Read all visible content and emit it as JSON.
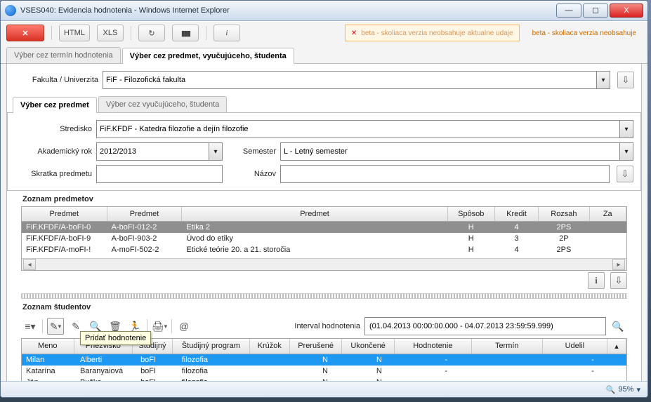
{
  "window": {
    "title": "VSES040: Evidencia hodnotenia - Windows Internet Explorer"
  },
  "toolbar": {
    "html": "HTML",
    "xls": "XLS"
  },
  "banner": {
    "msg": "beta - skoliaca verzia neobsahuje aktualne udaje",
    "msg2": "beta - skoliaca verzia neobsahuje"
  },
  "tabs_main": [
    {
      "label": "Výber cez termín hodnotenia"
    },
    {
      "label": "Výber cez predmet, vyučujúceho, študenta"
    }
  ],
  "form": {
    "fakulta_label": "Fakulta / Univerzita",
    "fakulta_value": "FiF - Filozofická fakulta"
  },
  "tabs_sub": [
    {
      "label": "Výber cez predmet"
    },
    {
      "label": "Výber cez vyučujúceho, študenta"
    }
  ],
  "filters": {
    "stredisko_label": "Stredisko",
    "stredisko_value": "FiF.KFDF - Katedra filozofie a dejín filozofie",
    "akrok_label": "Akademický rok",
    "akrok_value": "2012/2013",
    "semester_label": "Semester",
    "semester_value": "L - Letný semester",
    "skratka_label": "Skratka predmetu",
    "skratka_value": "",
    "nazov_label": "Názov",
    "nazov_value": ""
  },
  "section_predmety": "Zoznam predmetov",
  "grid1": {
    "cols": [
      "Predmet",
      "Predmet",
      "Predmet",
      "Spôsob",
      "Kredit",
      "Rozsah",
      "Za"
    ],
    "rows": [
      {
        "c": [
          "FiF.KFDF/A-boFI-0",
          "A-boFI-012-2",
          "Etika 2",
          "H",
          "4",
          "2PS",
          ""
        ],
        "sel": true
      },
      {
        "c": [
          "FiF.KFDF/A-boFI-9",
          "A-boFI-903-2",
          "Úvod do etiky",
          "H",
          "3",
          "2P",
          ""
        ]
      },
      {
        "c": [
          "FiF.KFDF/A-moFI-!",
          "A-moFI-502-2",
          "Etické teórie 20. a 21. storočia",
          "H",
          "4",
          "2PS",
          ""
        ]
      }
    ]
  },
  "section_studenti": "Zoznam študentov",
  "interval": {
    "label": "Interval hodnotenia",
    "value": "(01.04.2013 00:00:00.000 - 04.07.2013 23:59:59.999)"
  },
  "tooltip": "Pridať hodnotenie",
  "grid2": {
    "cols": [
      "Meno",
      "Priezvisko",
      "Študijný",
      "Študijný program",
      "Krúžok",
      "Prerušené",
      "Ukončené",
      "Hodnotenie",
      "Termín",
      "Udelil",
      ""
    ],
    "rows": [
      {
        "c": [
          "Milan",
          "Alberti",
          "boFI",
          "filozofia",
          "",
          "N",
          "N",
          "-",
          "",
          "-"
        ],
        "sel": true
      },
      {
        "c": [
          "Katarína",
          "Baranyaiová",
          "boFI",
          "filozofia",
          "",
          "N",
          "N",
          "-",
          "",
          "-"
        ]
      },
      {
        "c": [
          "Ján",
          "Buška",
          "boFI",
          "filozofia",
          "",
          "N",
          "N",
          "-",
          "",
          "-"
        ]
      }
    ]
  },
  "status": {
    "zoom": "95%"
  }
}
